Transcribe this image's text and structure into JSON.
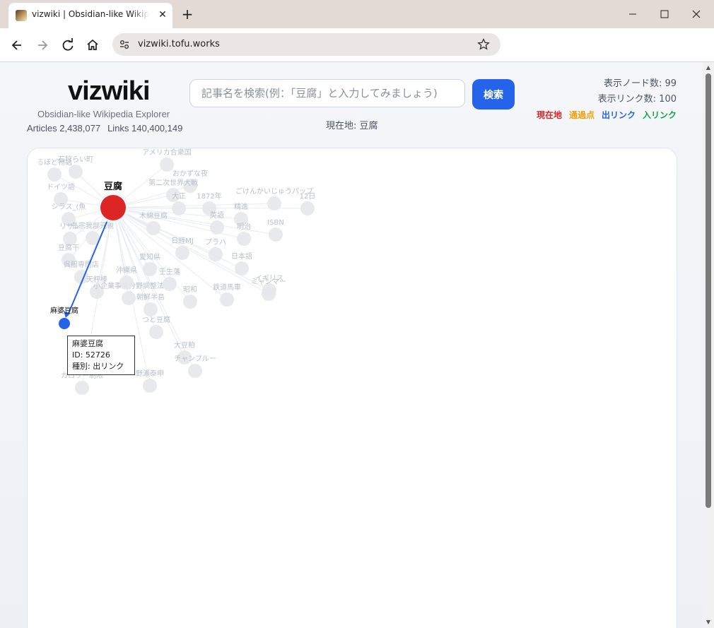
{
  "browser": {
    "tab_title": "vizwiki | Obsidian-like Wikipedia Explorer",
    "url": "vizwiki.tofu.works"
  },
  "header": {
    "brand": "vizwiki",
    "subtitle": "Obsidian-like Wikipedia Explorer",
    "articles": "Articles 2,438,077",
    "links": "Links 140,400,149"
  },
  "search": {
    "placeholder": "記事名を検索(例：「豆腐」と入力してみましょう)",
    "button": "検索",
    "current": "現在地: 豆腐"
  },
  "counts": {
    "nodes": "表示ノード数: 99",
    "links": "表示リンク数: 100"
  },
  "legend": {
    "current": "現在地",
    "visited": "通過点",
    "outlink": "出リンク",
    "inlink": "入リンク",
    "colors": {
      "current": "#dc2626",
      "visited": "#f59e0b",
      "outlink": "#2563eb",
      "inlink": "#16a34a"
    }
  },
  "graph": {
    "center": "豆腐",
    "selected": "麻婆豆腐",
    "faded_labels": [
      "るほど物語",
      "石狩らい町",
      "ドイツ語",
      "シラス_(魚",
      "リサン",
      "長宗我部元親",
      "豆腐干",
      "呉服専門店",
      "天秤棒",
      "小企業事業分野調整法",
      "朝鮮半島",
      "つと豆腐",
      "大豆粕",
      "チャンプルー",
      "野瀬泰申",
      "カロリー制限",
      "アメリカ合衆国",
      "おかずな夜",
      "第二次世界大戦",
      "大正",
      "ごけんかいじゅうパップ",
      "木綿豆腐",
      "1872年",
      "英語",
      "精進",
      "ISBN",
      "明治",
      "日経MJ",
      "プラハ",
      "愛知県",
      "日本語",
      "沖縄県",
      "壬生藩",
      "イギリス",
      "鉄道馬車",
      "昭和",
      "ミャンマー",
      "12日"
    ]
  },
  "tooltip": {
    "name": "麻婆豆腐",
    "id": "ID: 52726",
    "kind": "種別: 出リンク"
  }
}
